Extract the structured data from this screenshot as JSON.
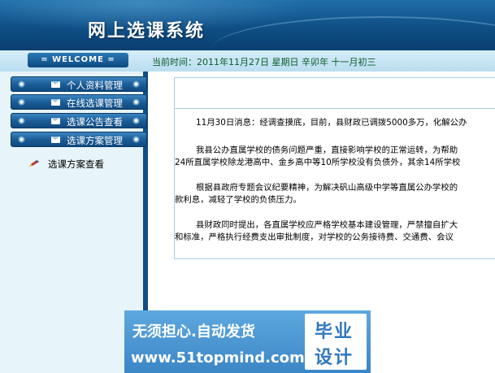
{
  "header": {
    "title": "网上选课系统"
  },
  "statusbar": {
    "welcome": "= WELCOME =",
    "datetime": "当前时间：2011年11月27日 星期日 辛卯年 十一月初三"
  },
  "sidebar": {
    "items": [
      {
        "label": "个人资料管理"
      },
      {
        "label": "在线选课管理"
      },
      {
        "label": "选课公告查看"
      },
      {
        "label": "选课方案管理"
      }
    ],
    "sub_item": {
      "label": "选课方案查看",
      "icon": "pencil-icon"
    }
  },
  "content": {
    "paragraphs": [
      {
        "lines": [
          "11月30日消息：经调查摸底，目前，县财政已调拨5000多万，化解公办"
        ]
      },
      {
        "lines": [
          "我县公办直属学校的债务问题严重，直接影响学校的正常运转，为帮助",
          "24所直属学校除龙港高中、金乡高中等10所学校没有负债外，其余14所学校"
        ]
      },
      {
        "lines": [
          "根据县政府专题会议纪要精神，为解决矾山高级中学等直属公办学校的",
          "款利息，减轻了学校的负债压力。"
        ]
      },
      {
        "lines": [
          "县财政同时提出，各直属学校应严格学校基本建设管理，严禁擅自扩大",
          "和标准，严格执行经费支出审批制度，对学校的公务接待费、交通费、会议"
        ]
      }
    ]
  },
  "watermark": {
    "line1": "无须担心.自动发货",
    "line2": "www.51topmind.com",
    "box_line1": "毕业",
    "box_line2": "设计"
  }
}
